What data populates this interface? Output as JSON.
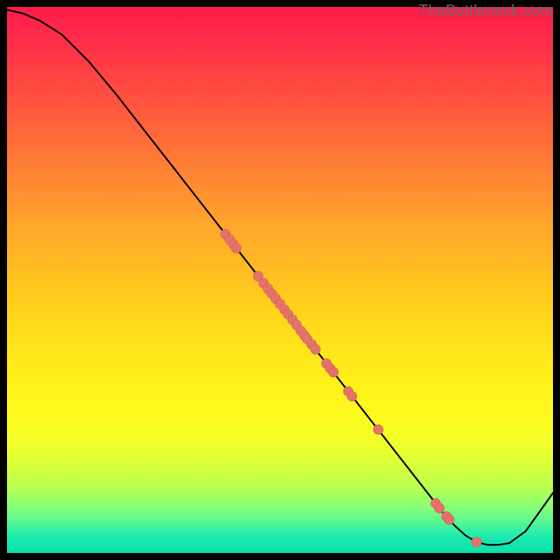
{
  "watermark": "TheBottleneck.com",
  "colors": {
    "curve": "#000000",
    "marker_fill": "#e6736b",
    "marker_stroke": "#c85a52",
    "frame": "#000000"
  },
  "chart_data": {
    "type": "line",
    "title": "",
    "xlabel": "",
    "ylabel": "",
    "xlim": [
      0,
      100
    ],
    "ylim": [
      0,
      100
    ],
    "grid": false,
    "legend": false,
    "series": [
      {
        "name": "bottleneck-curve",
        "x": [
          0,
          3,
          6,
          10,
          15,
          20,
          25,
          30,
          35,
          40,
          45,
          50,
          55,
          60,
          65,
          70,
          75,
          80,
          82,
          84,
          86,
          88,
          90,
          92,
          95,
          100
        ],
        "y": [
          99.5,
          98.8,
          97.5,
          95.0,
          90.0,
          84.0,
          77.6,
          71.2,
          64.8,
          58.4,
          52.0,
          45.6,
          39.2,
          32.8,
          26.4,
          20.0,
          13.6,
          7.2,
          5.0,
          3.2,
          2.0,
          1.5,
          1.5,
          1.8,
          4.0,
          11.0
        ]
      }
    ],
    "markers": [
      {
        "x": 40.0,
        "y": 58.4
      },
      {
        "x": 40.8,
        "y": 57.4
      },
      {
        "x": 41.5,
        "y": 56.5
      },
      {
        "x": 42.0,
        "y": 55.8
      },
      {
        "x": 46.0,
        "y": 50.7
      },
      {
        "x": 47.0,
        "y": 49.4
      },
      {
        "x": 47.8,
        "y": 48.4
      },
      {
        "x": 48.5,
        "y": 47.5
      },
      {
        "x": 49.2,
        "y": 46.6
      },
      {
        "x": 50.0,
        "y": 45.6
      },
      {
        "x": 50.8,
        "y": 44.6
      },
      {
        "x": 51.5,
        "y": 43.7
      },
      {
        "x": 52.3,
        "y": 42.7
      },
      {
        "x": 53.0,
        "y": 41.8
      },
      {
        "x": 53.8,
        "y": 40.7
      },
      {
        "x": 54.5,
        "y": 39.8
      },
      {
        "x": 55.0,
        "y": 39.2
      },
      {
        "x": 55.8,
        "y": 38.2
      },
      {
        "x": 56.5,
        "y": 37.3
      },
      {
        "x": 58.5,
        "y": 34.7
      },
      {
        "x": 59.2,
        "y": 33.8
      },
      {
        "x": 59.8,
        "y": 33.1
      },
      {
        "x": 62.5,
        "y": 29.6
      },
      {
        "x": 63.2,
        "y": 28.7
      },
      {
        "x": 68.0,
        "y": 22.6
      },
      {
        "x": 78.5,
        "y": 9.1
      },
      {
        "x": 79.2,
        "y": 8.2
      },
      {
        "x": 80.5,
        "y": 6.7
      },
      {
        "x": 81.0,
        "y": 6.1
      },
      {
        "x": 86.0,
        "y": 2.0
      }
    ],
    "note": "No axis tick labels or numeric annotations are visible in the image; x and y ranges are normalized 0–100. Marker y-values are placed on the curve."
  }
}
